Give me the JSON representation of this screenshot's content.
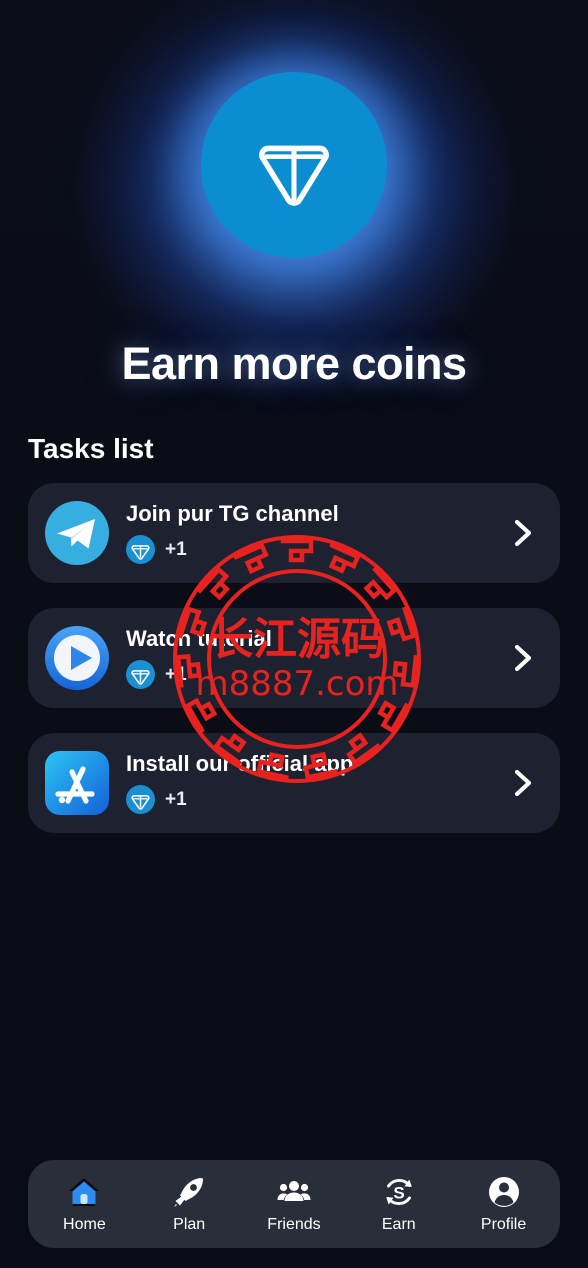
{
  "app": {
    "background_color": "#0a0c16",
    "accent_color": "#0b8ed1",
    "card_color": "#1e2230",
    "nav_color": "#2a2e3a"
  },
  "hero": {
    "logo_icon": "ton-coin-icon",
    "logo_circle_color": "#0b8ed1",
    "glow_color": "#4a90ff"
  },
  "header": {
    "title": "Earn more coins",
    "section_title": "Tasks list"
  },
  "tasks": [
    {
      "icon": "telegram-icon",
      "title": "Join pur TG channel",
      "reward_icon": "ton-coin-icon",
      "reward": "+1",
      "chevron": "chevron-right-icon"
    },
    {
      "icon": "play-circle-icon",
      "title": "Watch tutorial",
      "reward_icon": "ton-coin-icon",
      "reward": "+1",
      "chevron": "chevron-right-icon"
    },
    {
      "icon": "app-store-icon",
      "title": "Install our official app",
      "reward_icon": "ton-coin-icon",
      "reward": "+1",
      "chevron": "chevron-right-icon"
    }
  ],
  "bottom_nav": {
    "active_index": 0,
    "active_color": "#2d8cf0",
    "items": [
      {
        "label": "Home",
        "icon": "home-icon"
      },
      {
        "label": "Plan",
        "icon": "rocket-icon"
      },
      {
        "label": "Friends",
        "icon": "people-icon"
      },
      {
        "label": "Earn",
        "icon": "currency-exchange-icon"
      },
      {
        "label": "Profile",
        "icon": "person-circle-icon"
      }
    ]
  },
  "watermark": {
    "text_primary": "长江源码",
    "text_secondary": "m8887.com",
    "color": "#e8231f"
  }
}
